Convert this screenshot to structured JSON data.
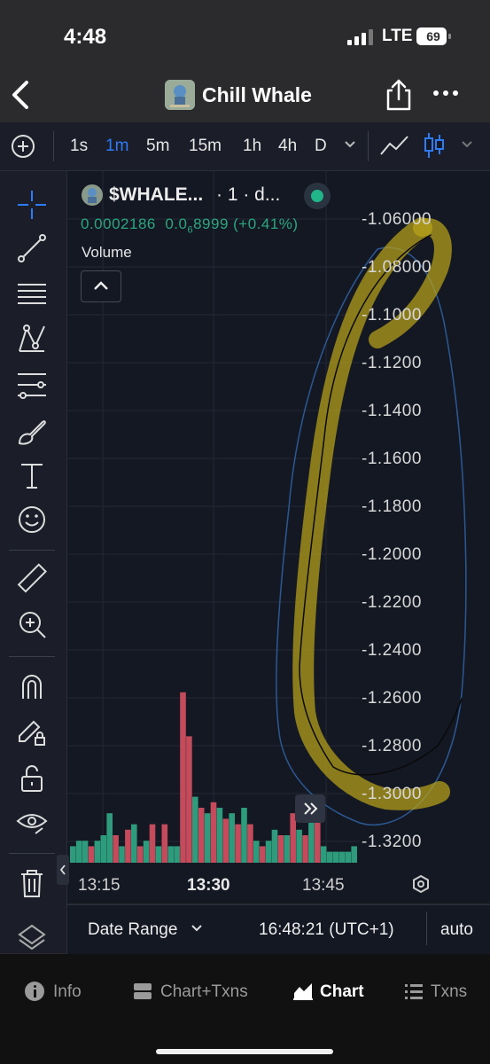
{
  "status_bar": {
    "time": "4:48",
    "network": "LTE",
    "battery": "69"
  },
  "nav": {
    "title": "Chill Whale"
  },
  "toolbar": {
    "timeframes": [
      "1s",
      "1m",
      "5m",
      "15m",
      "1h",
      "4h",
      "D"
    ],
    "active_timeframe": "1m"
  },
  "legend": {
    "symbol": "$WHALE...",
    "interval": "· 1 · d...",
    "price": "0.0002186",
    "change_prefix": "0.0",
    "change_subscript": "6",
    "change_suffix": "8999 (+0.41%)",
    "volume_label": "Volume"
  },
  "y_axis_labels": [
    "-1.06000",
    "-1.08000",
    "-1.1000",
    "-1.1200",
    "-1.1400",
    "-1.1600",
    "-1.1800",
    "-1.2000",
    "-1.2200",
    "-1.2400",
    "-1.2600",
    "-1.2800",
    "-1.3000",
    "-1.3200"
  ],
  "x_axis_labels": [
    "13:15",
    "13:30",
    "13:45"
  ],
  "footer": {
    "date_range": "Date Range",
    "clock": "16:48:21 (UTC+1)",
    "scale": "auto"
  },
  "bottom_tabs": [
    "Info",
    "Chart+Txns",
    "Chart",
    "Txns"
  ],
  "active_tab": "Chart",
  "colors": {
    "up": "#2e9c7c",
    "down": "#c44b5b",
    "accent": "#2d7bf6",
    "highlight": "#b9a21a",
    "panel": "#1b1e29",
    "chart_bg": "#141823"
  },
  "chart_data": {
    "type": "bar",
    "title": "",
    "series": [
      {
        "values": [
          3,
          4,
          4,
          3,
          4,
          5,
          9,
          5,
          3,
          6,
          7,
          3,
          4,
          7,
          3,
          7,
          3,
          3,
          31,
          23,
          12,
          10,
          9,
          11,
          10,
          8,
          9,
          7,
          10,
          7,
          4,
          3,
          4,
          6,
          5,
          5,
          9,
          6,
          5,
          10,
          9,
          3,
          2,
          2,
          2,
          2,
          3
        ]
      }
    ],
    "bar_colors": [
      "up",
      "up",
      "up",
      "down",
      "up",
      "up",
      "up",
      "down",
      "up",
      "down",
      "up",
      "down",
      "up",
      "down",
      "up",
      "down",
      "up",
      "up",
      "down",
      "down",
      "up",
      "down",
      "up",
      "down",
      "up",
      "down",
      "up",
      "down",
      "up",
      "down",
      "up",
      "down",
      "up",
      "up",
      "down",
      "up",
      "down",
      "up",
      "down",
      "up",
      "down",
      "up",
      "up",
      "up",
      "up",
      "up",
      "up"
    ],
    "x_ticks": [
      "13:15",
      "13:30",
      "13:45"
    ],
    "y_ticks": [
      "-1.06000",
      "-1.08000",
      "-1.1000",
      "-1.1200",
      "-1.1400",
      "-1.1600",
      "-1.1800",
      "-1.2000",
      "-1.2200",
      "-1.2400",
      "-1.2600",
      "-1.2800",
      "-1.3000",
      "-1.3200"
    ],
    "grid": true
  }
}
